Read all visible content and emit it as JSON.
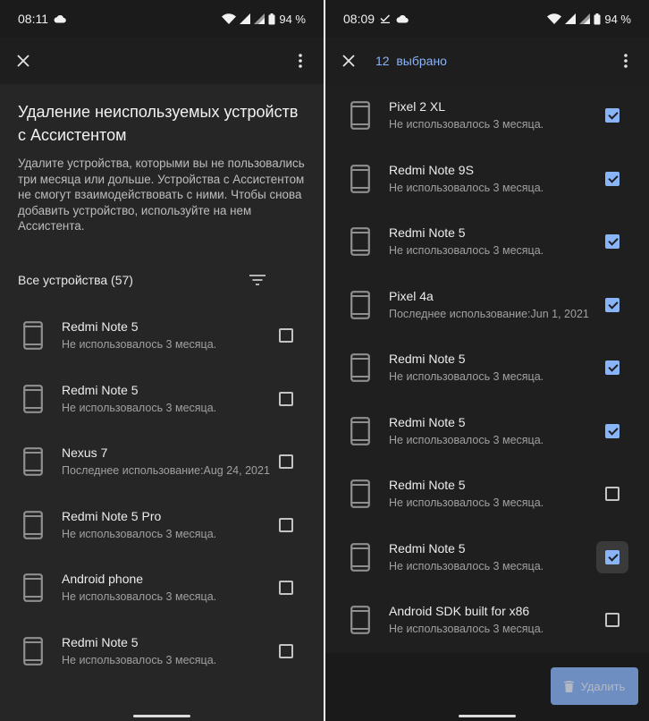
{
  "left_screen": {
    "status": {
      "time": "08:11",
      "battery": "94 %"
    },
    "title": "Удаление неиспользуемых устройств с Ассистентом",
    "description": "Удалите устройства, которыми вы не пользовались три месяца или дольше. Устройства с Ассистентом не смогут взаимодействовать с ними. Чтобы снова добавить устройство, используйте на нем Ассистента.",
    "filter_label": "Все устройства (57)",
    "devices": [
      {
        "name": "Redmi Note 5",
        "status": "Не использовалось 3 месяца.",
        "checked": false
      },
      {
        "name": "Redmi Note 5",
        "status": "Не использовалось 3 месяца.",
        "checked": false
      },
      {
        "name": "Nexus 7",
        "status": "Последнее использование:Aug 24, 2021",
        "checked": false
      },
      {
        "name": "Redmi Note 5 Pro",
        "status": "Не использовалось 3 месяца.",
        "checked": false
      },
      {
        "name": "Android phone",
        "status": "Не использовалось 3 месяца.",
        "checked": false
      },
      {
        "name": "Redmi Note 5",
        "status": "Не использовалось 3 месяца.",
        "checked": false
      }
    ]
  },
  "right_screen": {
    "status": {
      "time": "08:09",
      "battery": "94 %"
    },
    "selected_count": "12",
    "selected_label": "выбрано",
    "devices": [
      {
        "name": "Pixel 2 XL",
        "status": "Не использовалось 3 месяца.",
        "checked": true
      },
      {
        "name": "Redmi Note 9S",
        "status": "Не использовалось 3 месяца.",
        "checked": true
      },
      {
        "name": "Redmi Note 5",
        "status": "Не использовалось 3 месяца.",
        "checked": true
      },
      {
        "name": "Pixel 4a",
        "status": "Последнее использование:Jun 1, 2021",
        "checked": true
      },
      {
        "name": "Redmi Note 5",
        "status": "Не использовалось 3 месяца.",
        "checked": true
      },
      {
        "name": "Redmi Note 5",
        "status": "Не использовалось 3 месяца.",
        "checked": true
      },
      {
        "name": "Redmi Note 5",
        "status": "Не использовалось 3 месяца.",
        "checked": false
      },
      {
        "name": "Redmi Note 5",
        "status": "Не использовалось 3 месяца.",
        "checked": true,
        "focused": true
      },
      {
        "name": "Android SDK built for x86",
        "status": "Не использовалось 3 месяца.",
        "checked": false
      }
    ],
    "delete_label": "Удалить"
  },
  "colors": {
    "accent": "#8ab4f8",
    "background": "#262626",
    "surface": "#1e1e1e"
  },
  "icons": {
    "device": "phone-icon",
    "close": "close-icon",
    "more": "more-vert-icon",
    "filter": "filter-icon",
    "delete": "trash-icon"
  }
}
